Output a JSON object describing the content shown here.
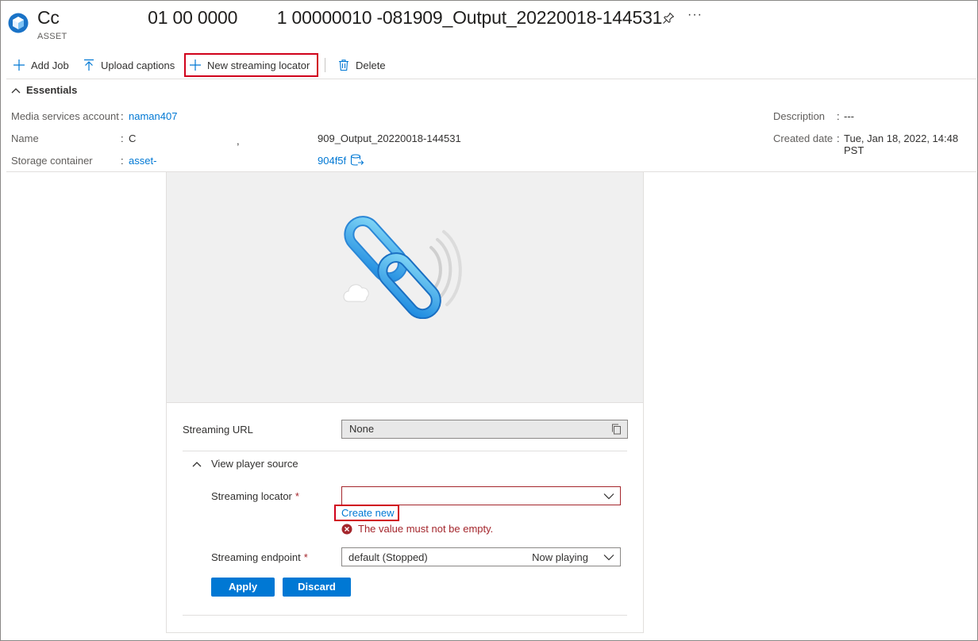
{
  "header": {
    "title": "Cc                  01 00 0000        1 00000010 -081909_Output_20220018-144531",
    "subtitle": "ASSET",
    "more_label": "···",
    "icons": [
      "asset-logo-icon",
      "pin-icon",
      "more-icon"
    ]
  },
  "toolbar": {
    "add_job": "Add Job",
    "upload_captions": "Upload captions",
    "new_streaming_locator": "New streaming locator",
    "delete": "Delete"
  },
  "essentials": {
    "toggle_label": "Essentials",
    "colon": ":",
    "media_services_account": {
      "label": "Media services account",
      "value": "naman407"
    },
    "name": {
      "label": "Name",
      "value_start": "C",
      "value_mid": ",",
      "value_end": "909_Output_20220018-144531"
    },
    "storage_container": {
      "label": "Storage container",
      "value_start": "asset-",
      "value_end": "904f5f"
    },
    "description": {
      "label": "Description",
      "value": "---"
    },
    "created_date": {
      "label": "Created date",
      "value": "Tue, Jan 18, 2022, 14:48 PST"
    }
  },
  "player": {
    "streaming_url": {
      "label": "Streaming URL",
      "value": "None"
    },
    "view_player_source": "View player source",
    "streaming_locator": {
      "label": "Streaming locator",
      "required_mark": "*",
      "value": "",
      "create_new": "Create new",
      "error": "The value must not be empty."
    },
    "streaming_endpoint": {
      "label": "Streaming endpoint",
      "required_mark": "*",
      "value": "default (Stopped)",
      "status": "Now playing"
    },
    "apply_label": "Apply",
    "discard_label": "Discard"
  },
  "colors": {
    "accent": "#0078d4",
    "error": "#a4262c",
    "highlight": "#d0021b"
  }
}
